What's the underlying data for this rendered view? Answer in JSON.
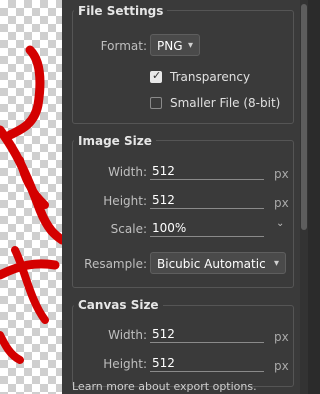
{
  "file_settings": {
    "title": "File Settings",
    "format_label": "Format:",
    "format_value": "PNG",
    "transparency_label": "Transparency",
    "transparency_checked": true,
    "smaller_file_label": "Smaller File (8-bit)",
    "smaller_file_checked": false
  },
  "image_size": {
    "title": "Image Size",
    "width_label": "Width:",
    "width_value": "512",
    "height_label": "Height:",
    "height_value": "512",
    "unit": "px",
    "scale_label": "Scale:",
    "scale_value": "100%",
    "resample_label": "Resample:",
    "resample_value": "Bicubic Automatic"
  },
  "canvas_size": {
    "title": "Canvas Size",
    "width_label": "Width:",
    "width_value": "512",
    "height_label": "Height:",
    "height_value": "512",
    "unit": "px"
  },
  "footer": {
    "link_text": "Learn more about export options."
  },
  "colors": {
    "panel": "#3a3a3a",
    "stroke": "#d40000"
  },
  "icons": {
    "chevron": "chevron-down-icon",
    "check": "check-icon"
  }
}
